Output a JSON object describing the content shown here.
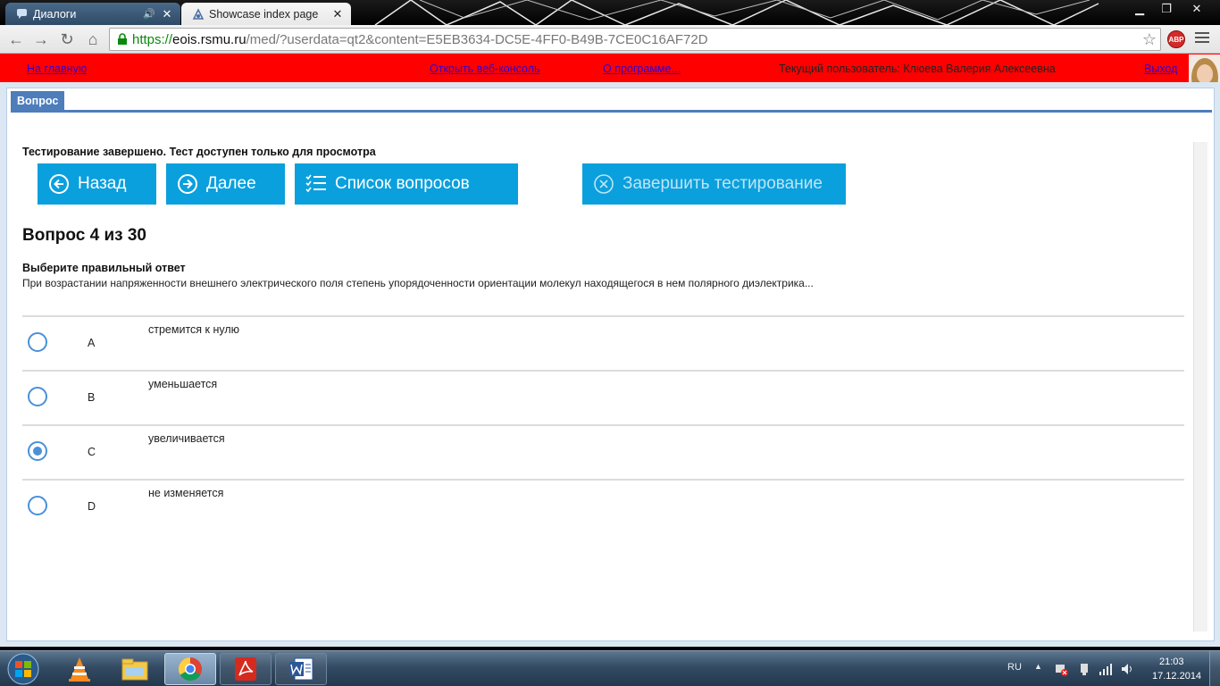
{
  "browser": {
    "tabs": [
      {
        "title": "Диалоги",
        "active": false
      },
      {
        "title": "Showcase index page",
        "active": true
      }
    ],
    "url": {
      "scheme": "https://",
      "host": "eois.rsmu.ru",
      "path": "/med/?userdata=qt2&content=E5EB3634-DC5E-4FF0-B49B-7CE0C16AF72D"
    },
    "extension_label": "ABP"
  },
  "header": {
    "home_link": "На главную",
    "console_link": "Открыть веб-консоль",
    "about_link": "О программе...",
    "current_user": "Текущий пользователь: Клюева Валерия Алексеевна",
    "logout_link": "Выход"
  },
  "panel": {
    "tab_label": "Вопрос"
  },
  "test": {
    "status": "Тестирование завершено. Тест доступен только для просмотра",
    "buttons": {
      "back": "Назад",
      "next": "Далее",
      "list": "Список вопросов",
      "finish": "Завершить тестирование"
    },
    "question_title": "Вопрос 4 из 30",
    "instruction": "Выберите правильный ответ",
    "question_text": "При возрастании напряженности внешнего электрического поля степень упорядоченности ориентации молекул находящегося в нем полярного диэлектрика...",
    "options": [
      {
        "letter": "A",
        "text": "стремится к нулю",
        "selected": false
      },
      {
        "letter": "B",
        "text": "уменьшается",
        "selected": false
      },
      {
        "letter": "C",
        "text": "увеличивается",
        "selected": true
      },
      {
        "letter": "D",
        "text": "не изменяется",
        "selected": false
      }
    ]
  },
  "taskbar": {
    "language": "RU",
    "time": "21:03",
    "date": "17.12.2014"
  },
  "colors": {
    "header_bg": "#ff0000",
    "header_link": "#3300cc",
    "button_bg": "#0aa0dd",
    "panel_accent": "#4d7dbb",
    "radio": "#4a90d9"
  }
}
